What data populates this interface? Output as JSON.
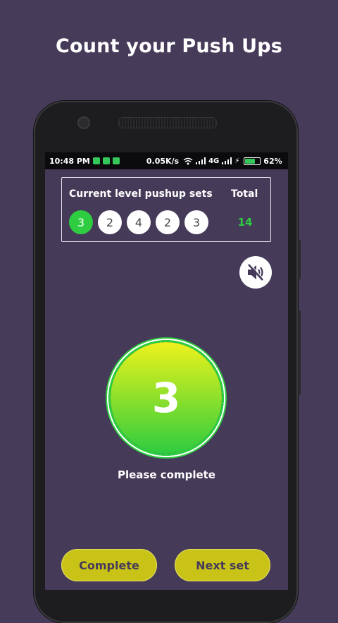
{
  "headline": "Count your Push Ups",
  "statusbar": {
    "time": "10:48 PM",
    "speed": "0.05K/s",
    "network": "4G",
    "battery": "62%"
  },
  "sets": {
    "title": "Current level pushup sets",
    "total_label": "Total",
    "items": [
      "3",
      "2",
      "4",
      "2",
      "3"
    ],
    "active_index": 0,
    "total": "14"
  },
  "mute_icon": "speaker-muted-icon",
  "counter": {
    "value": "3",
    "status": "Please complete"
  },
  "buttons": {
    "complete": "Complete",
    "next": "Next set"
  },
  "colors": {
    "background": "#473b5a",
    "accent": "#2ecc40",
    "button": "#c9c318"
  }
}
